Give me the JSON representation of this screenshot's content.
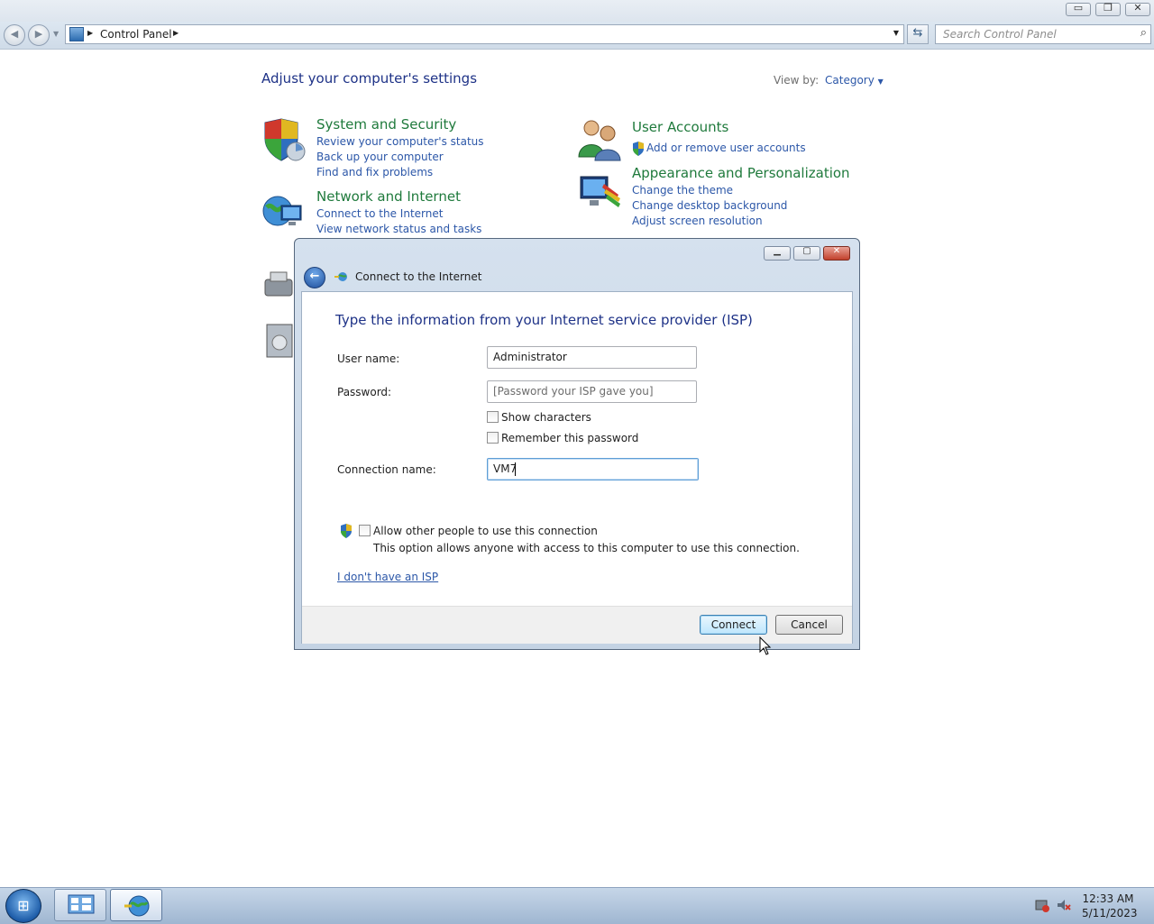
{
  "window": {
    "caption_buttons": [
      "minimize",
      "restore",
      "close"
    ]
  },
  "addressbar": {
    "crumb": "Control Panel",
    "search_placeholder": "Search Control Panel"
  },
  "controlpanel": {
    "title": "Adjust your computer's settings",
    "viewby_label": "View by:",
    "viewby_value": "Category",
    "categories": [
      {
        "title": "System and Security",
        "icon": "shield-icon",
        "links": [
          "Review your computer's status",
          "Back up your computer",
          "Find and fix problems"
        ]
      },
      {
        "title": "Network and Internet",
        "icon": "globe-network-icon",
        "links": [
          "Connect to the Internet",
          "View network status and tasks"
        ]
      },
      {
        "title": "User Accounts",
        "icon": "users-icon",
        "links": [
          "Add or remove user accounts"
        ]
      },
      {
        "title": "Appearance and Personalization",
        "icon": "monitor-paint-icon",
        "links": [
          "Change the theme",
          "Change desktop background",
          "Adjust screen resolution"
        ]
      }
    ]
  },
  "dialog": {
    "title": "Connect to the Internet",
    "heading": "Type the information from your Internet service provider (ISP)",
    "username_label": "User name:",
    "username_value": "Administrator",
    "password_label": "Password:",
    "password_placeholder": "[Password your ISP gave you]",
    "show_chars_label": "Show characters",
    "remember_label": "Remember this password",
    "connection_label": "Connection name:",
    "connection_value": "VM7",
    "allow_label": "Allow other people to use this connection",
    "allow_desc": "This option allows anyone with access to this computer to use this connection.",
    "no_isp_link": "I don't have an ISP",
    "connect_button": "Connect",
    "cancel_button": "Cancel"
  },
  "taskbar": {
    "time": "12:33 AM",
    "date": "5/11/2023"
  },
  "colors": {
    "heading_blue": "#1e3287",
    "link_blue": "#2c57a8",
    "category_green": "#1f7a3c"
  }
}
